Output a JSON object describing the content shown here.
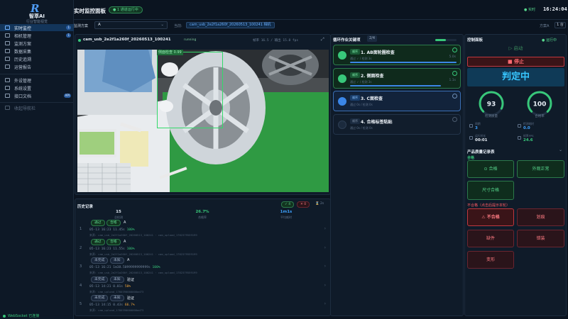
{
  "app": {
    "logo_mark": "R",
    "name": "智萃AI",
    "subtitle": "行业智能视觉"
  },
  "sidebar": {
    "items": [
      {
        "label": "实时监控",
        "badge": "1",
        "icon": "monitor-icon"
      },
      {
        "label": "相机管理",
        "badge": "1",
        "icon": "camera-icon"
      },
      {
        "label": "监测方案",
        "icon": "scheme-icon"
      },
      {
        "label": "数据采集",
        "icon": "database-icon"
      },
      {
        "label": "历史追溯",
        "icon": "history-icon"
      },
      {
        "label": "运营报告",
        "icon": "report-icon"
      }
    ],
    "items2": [
      {
        "label": "外设管理",
        "icon": "device-icon"
      },
      {
        "label": "系统设置",
        "icon": "gear-icon"
      },
      {
        "label": "接口文档",
        "badge": "API",
        "icon": "doc-icon"
      }
    ],
    "collapse": "收起导航栏",
    "ws_status": "WebSocket 已连接"
  },
  "header": {
    "title": "实时监控面板",
    "run_badge": "● 1 通道运行中",
    "live": "● 实时",
    "clock": "16:24:04"
  },
  "toolbar": {
    "scheme_label": "监测方案",
    "scheme_value": "A",
    "current_label": "当前:",
    "current_chip": "cam_usb_2e2f1a260f_20260513_100241 相机",
    "count_label": "方案A",
    "count_value": "1 台"
  },
  "camera": {
    "title": "cam_usb_2e2f1a260f_20260513_100241",
    "status": "running",
    "stats": "帧率 16.5 / 输出 15.8 fps",
    "detection_label": "侧面检查 0.99"
  },
  "history": {
    "title": "历史记录",
    "chips": [
      "✓ 4",
      "✕ 0",
      "⌛ 2s"
    ],
    "stats": [
      {
        "value": "15",
        "label": "总检测",
        "color": "#dfe7f1"
      },
      {
        "value": "26.7%",
        "label": "合格率",
        "color": "#38c77a"
      },
      {
        "value": "1m1s",
        "label": "平均耗时",
        "color": "#3ea2ff"
      }
    ],
    "rows": [
      {
        "idx": "1",
        "tags": [
          {
            "t": "通过",
            "c": "pass"
          },
          {
            "t": "合格",
            "c": "pass"
          }
        ],
        "code": "A",
        "meta": "05-13 16:23 11.45s",
        "pct": "100%",
        "pct_color": "#38c77a",
        "src": "来源: cam_usb_2e2f1a260f_20260513_100241 · cam_upload_1782379559199"
      },
      {
        "idx": "2",
        "tags": [
          {
            "t": "通过",
            "c": "pass"
          },
          {
            "t": "合格",
            "c": "pass"
          }
        ],
        "code": "A",
        "meta": "05-13 16:23 11.55s",
        "pct": "100%",
        "pct_color": "#38c77a",
        "src": "来源: cam_usb_2e2f1a260f_20260513_100241 · cam_upload_1782379559199"
      },
      {
        "idx": "3",
        "tags": [
          {
            "t": "未完成",
            "c": "unk"
          },
          {
            "t": "未知",
            "c": "unk"
          }
        ],
        "code": "A",
        "meta": "05-13 16:21 1m38.5099999999999s",
        "pct": "100%",
        "pct_color": "#38c77a",
        "src": "来源: cam_usb_2e2f1a260f_20260513_100241 · cam_upload_1782379559199"
      },
      {
        "idx": "4",
        "tags": [
          {
            "t": "未完成",
            "c": "unk"
          },
          {
            "t": "未知",
            "c": "unk"
          }
        ],
        "code": "验证",
        "meta": "05-13 14:21 0.01s",
        "pct": "50%",
        "pct_color": "#f0a43a",
        "src": "来源: cam_upload_1780390000000ad73"
      },
      {
        "idx": "5",
        "tags": [
          {
            "t": "未完成",
            "c": "unk"
          },
          {
            "t": "未知",
            "c": "unk"
          }
        ],
        "code": "验证",
        "meta": "05-13 14:15 0.43s",
        "pct": "66.7%",
        "pct_color": "#f0a43a",
        "src": "来源: cam_upload_1780390000000ad73"
      }
    ]
  },
  "steps": {
    "title": "循环作业关键项",
    "count": "2/4",
    "progress": 0.5,
    "items": [
      {
        "chip": "顺序",
        "name": "1. AB面轮圈检查",
        "sub": "通过 ✓ / 检测 3s",
        "dur": "5.0s",
        "state": "done",
        "bar": 1.0
      },
      {
        "chip": "顺序",
        "name": "2. 侧面检查",
        "sub": "通过 ✓ / 检测 3s",
        "dur": "1.1s",
        "state": "done",
        "bar": 0.85
      },
      {
        "chip": "顺序",
        "name": "3. C面检查",
        "sub": "通过 0s / 检测 0s",
        "dur": "",
        "state": "active",
        "bar": 0
      },
      {
        "chip": "顺序",
        "name": "4. 合格标签粘贴",
        "sub": "通过 0s / 检测 0s",
        "dur": "",
        "state": "pending",
        "bar": 0
      }
    ]
  },
  "control": {
    "title": "控制面板",
    "status": "● 运行中",
    "start": "▷ 启动",
    "stop": "■ 停止",
    "judge": "判定中",
    "gauges": [
      {
        "value": 93,
        "label": "检测质量",
        "color": "#38c77a"
      },
      {
        "value": 100,
        "label": "合格率",
        "color": "#38c77a"
      }
    ],
    "minis": [
      {
        "label": "周期",
        "value": "3",
        "color": "#3ea2ff"
      },
      {
        "label": "检测耗时",
        "value": "0.0",
        "color": "#3ea2ff"
      },
      {
        "label": "运行时长",
        "value": "00:01",
        "color": "#e6edf5"
      },
      {
        "label": "帧率FPS",
        "value": "24.6",
        "color": "#38c77a"
      }
    ]
  },
  "quality": {
    "title": "产品质量记录表",
    "ok_section": "合格",
    "ok_buttons": [
      "⊙ 合格",
      "外观正常",
      "尺寸合格"
    ],
    "ng_section": "不合格（点击后提示本轮）",
    "ng_buttons": [
      "⚠ 不合格",
      "划痕",
      "缺件",
      "错装",
      "变形"
    ]
  }
}
